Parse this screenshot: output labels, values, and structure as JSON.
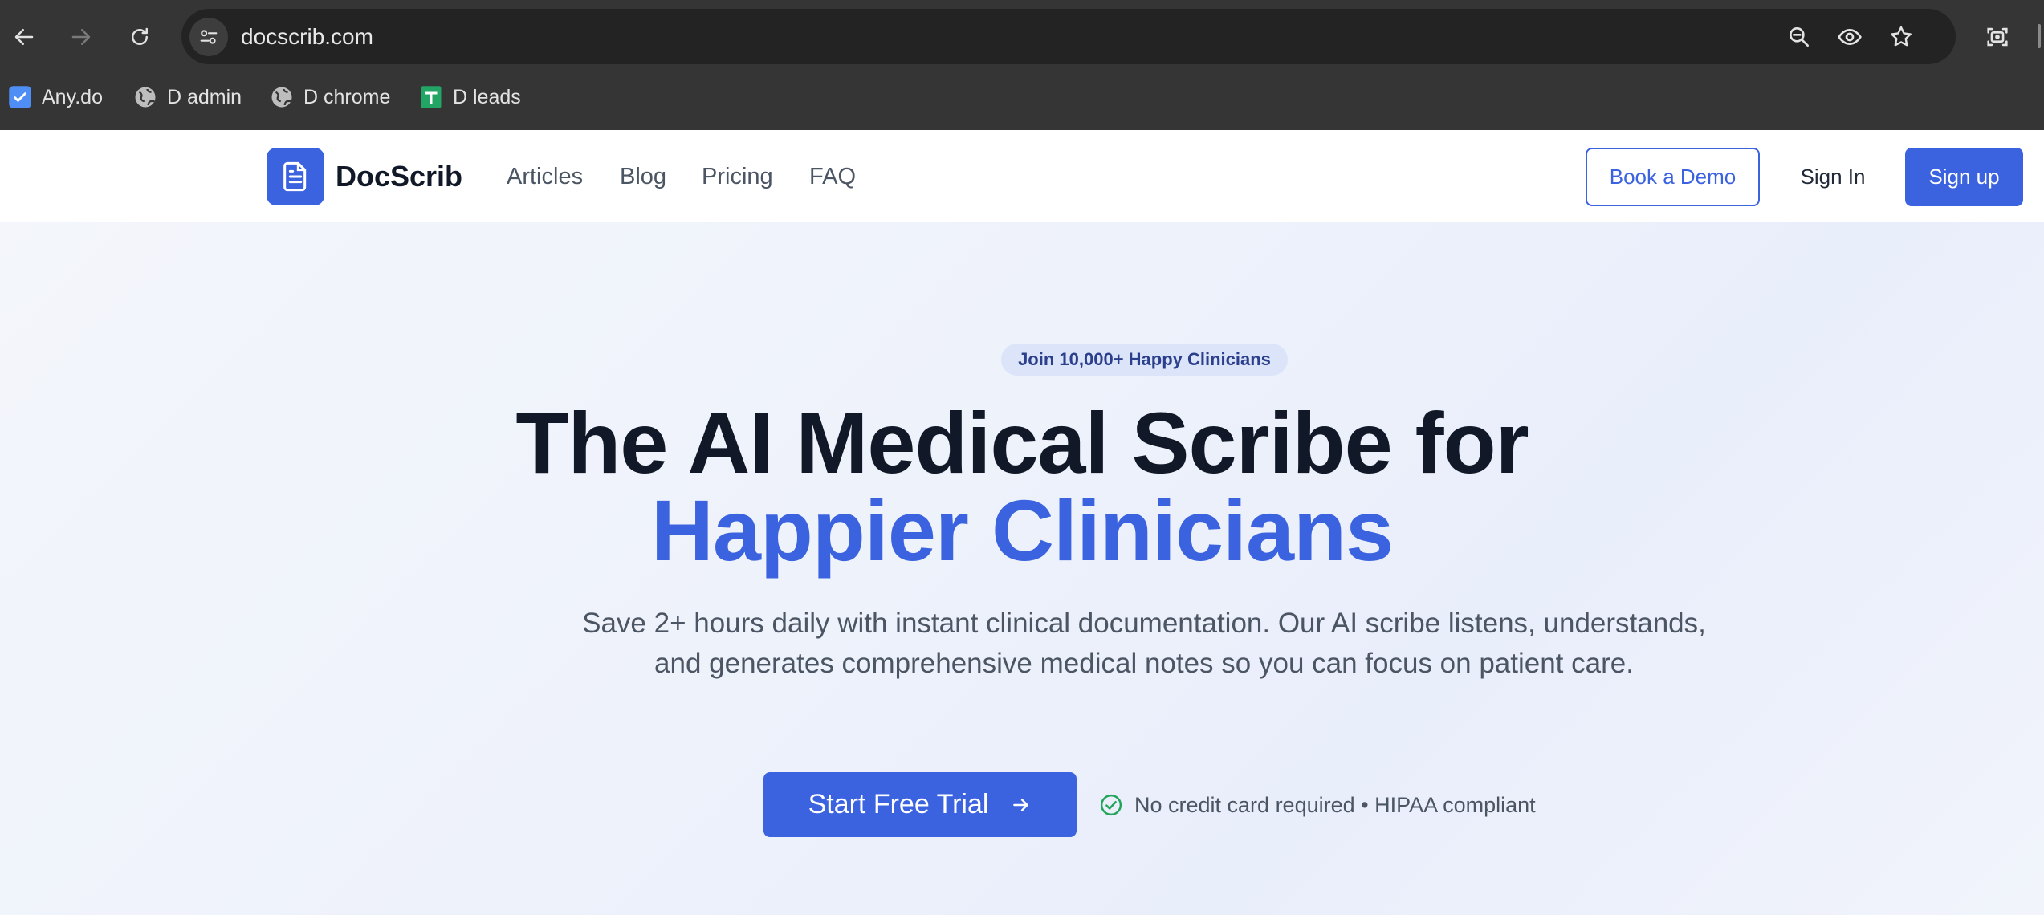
{
  "browser": {
    "url": "docscrib.com",
    "bookmarks": [
      {
        "label": "Any.do",
        "icon": "anydo-check-icon"
      },
      {
        "label": "D admin",
        "icon": "globe-icon"
      },
      {
        "label": "D chrome",
        "icon": "globe-icon"
      },
      {
        "label": "D leads",
        "icon": "sheets-icon"
      }
    ]
  },
  "header": {
    "brand": "DocScrib",
    "nav": [
      "Articles",
      "Blog",
      "Pricing",
      "FAQ"
    ],
    "book_demo": "Book a Demo",
    "sign_in": "Sign In",
    "sign_up": "Sign up"
  },
  "hero": {
    "badge": "Join 10,000+ Happy Clinicians",
    "title_line1": "The AI Medical Scribe for",
    "title_line2": "Happier Clinicians",
    "subtitle": "Save 2+ hours daily with instant clinical documentation. Our AI scribe listens, understands, and generates comprehensive medical notes so you can focus on patient care.",
    "cta": "Start Free Trial",
    "trust": "No credit card required • HIPAA compliant"
  },
  "colors": {
    "accent": "#3b63e0",
    "chrome_bg": "#353535",
    "omnibox_bg": "#232323",
    "check_green": "#16a34a"
  }
}
